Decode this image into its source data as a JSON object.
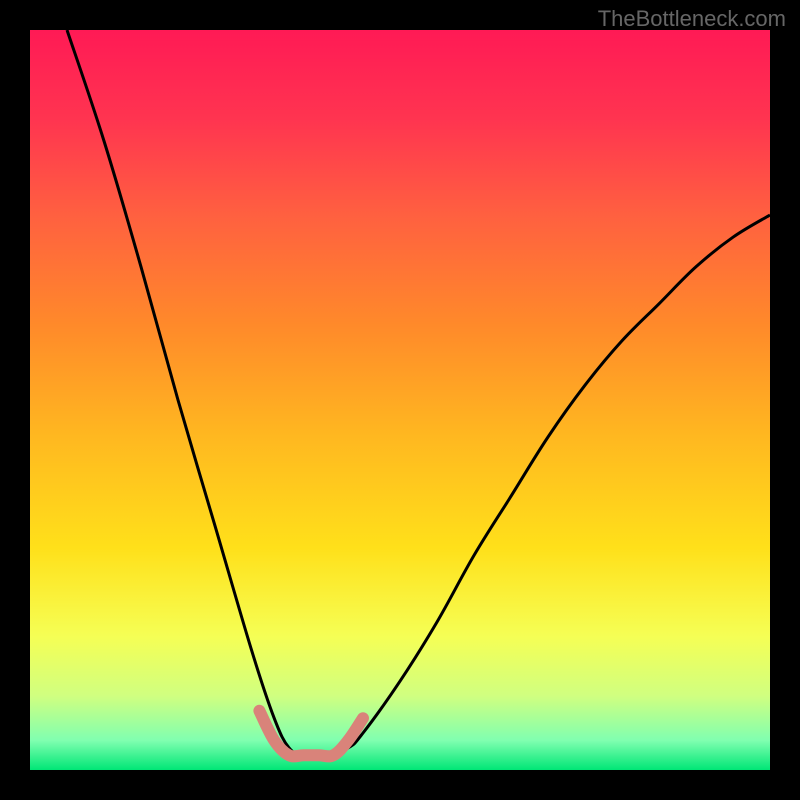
{
  "watermark": "TheBottleneck.com",
  "chart_data": {
    "type": "line",
    "title": "",
    "xlabel": "",
    "ylabel": "",
    "xlim": [
      0,
      100
    ],
    "ylim": [
      0,
      100
    ],
    "background": {
      "type": "vertical-gradient",
      "stops": [
        {
          "offset": 0.0,
          "color": "#ff1a55"
        },
        {
          "offset": 0.12,
          "color": "#ff3450"
        },
        {
          "offset": 0.25,
          "color": "#ff6040"
        },
        {
          "offset": 0.4,
          "color": "#ff8a2a"
        },
        {
          "offset": 0.55,
          "color": "#ffb820"
        },
        {
          "offset": 0.7,
          "color": "#ffe01a"
        },
        {
          "offset": 0.82,
          "color": "#f5ff55"
        },
        {
          "offset": 0.9,
          "color": "#d0ff80"
        },
        {
          "offset": 0.96,
          "color": "#80ffb0"
        },
        {
          "offset": 1.0,
          "color": "#00e676"
        }
      ]
    },
    "series": [
      {
        "name": "bottleneck-curve",
        "color": "#000000",
        "width": 3,
        "x": [
          5,
          10,
          15,
          20,
          25,
          30,
          33,
          35,
          37,
          40,
          43,
          45,
          50,
          55,
          60,
          65,
          70,
          75,
          80,
          85,
          90,
          95,
          100
        ],
        "y": [
          100,
          85,
          68,
          50,
          33,
          16,
          7,
          3,
          2,
          2,
          3,
          5,
          12,
          20,
          29,
          37,
          45,
          52,
          58,
          63,
          68,
          72,
          75
        ]
      },
      {
        "name": "optimal-marker",
        "color": "#d9837a",
        "width": 12,
        "linecap": "round",
        "x": [
          31,
          33,
          35,
          37,
          39,
          41,
          43,
          45
        ],
        "y": [
          8,
          4,
          2,
          2,
          2,
          2,
          4,
          7
        ]
      }
    ]
  }
}
